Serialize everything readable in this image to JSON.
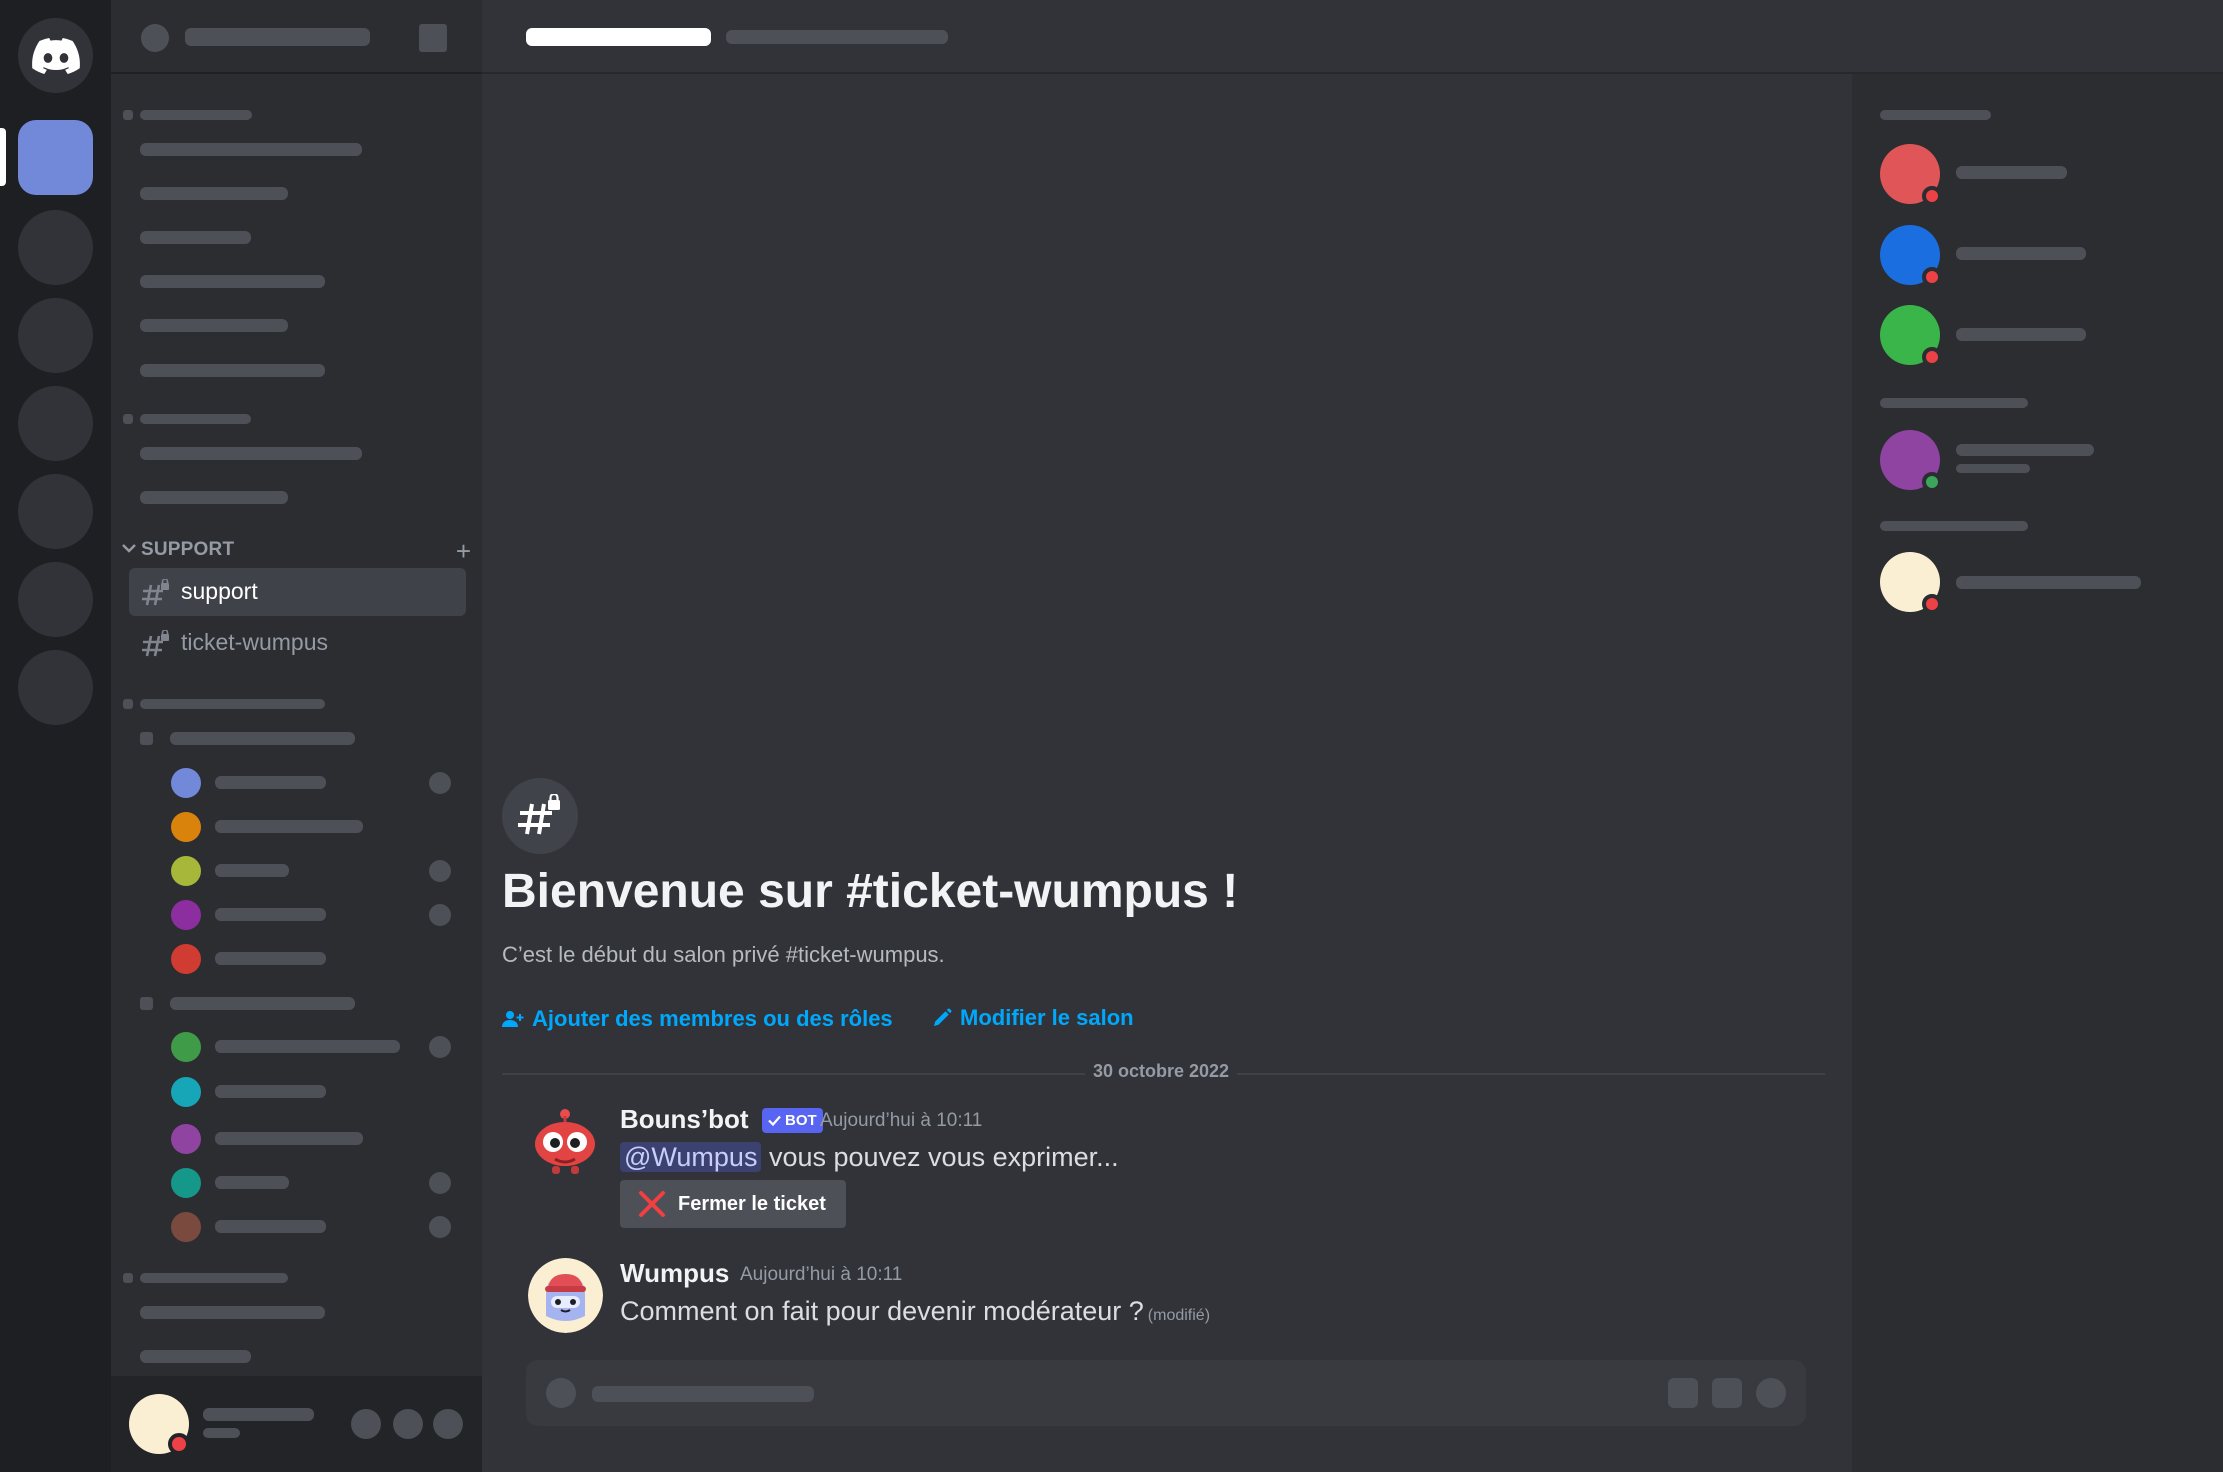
{
  "sidebar": {
    "category_support": "SUPPORT",
    "channels": [
      {
        "name": "support",
        "active": true
      },
      {
        "name": "ticket-wumpus",
        "active": false
      }
    ]
  },
  "welcome": {
    "title": "Bienvenue sur #ticket-wumpus !",
    "subtitle": "C’est le début du salon privé #ticket-wumpus.",
    "add_members": "Ajouter des membres ou des rôles",
    "edit_channel": "Modifier le salon"
  },
  "date_divider": "30 octobre 2022",
  "messages": [
    {
      "author": "Bouns’bot",
      "badge": "BOT",
      "time": "Aujourd’hui à 10:11",
      "mention": "@Wumpus",
      "text": " vous pouvez vous exprimer...",
      "button": "Fermer le ticket"
    },
    {
      "author": "Wumpus",
      "time": "Aujourd’hui à 10:11",
      "text": "Comment on fait pour devenir modérateur ?",
      "edited": "(modifié)"
    }
  ],
  "members": {
    "avatars": [
      "#e05558",
      "#1b6ee0",
      "#3ab54a",
      "#8e44a0",
      "#fbefd3"
    ],
    "status": [
      "#ed4245",
      "#ed4245",
      "#ed4245",
      "#3ba55c",
      "#ed4245"
    ]
  },
  "colors": {
    "accent": "#5865f2",
    "link": "#00a8fc",
    "server_active": "#7289da"
  }
}
